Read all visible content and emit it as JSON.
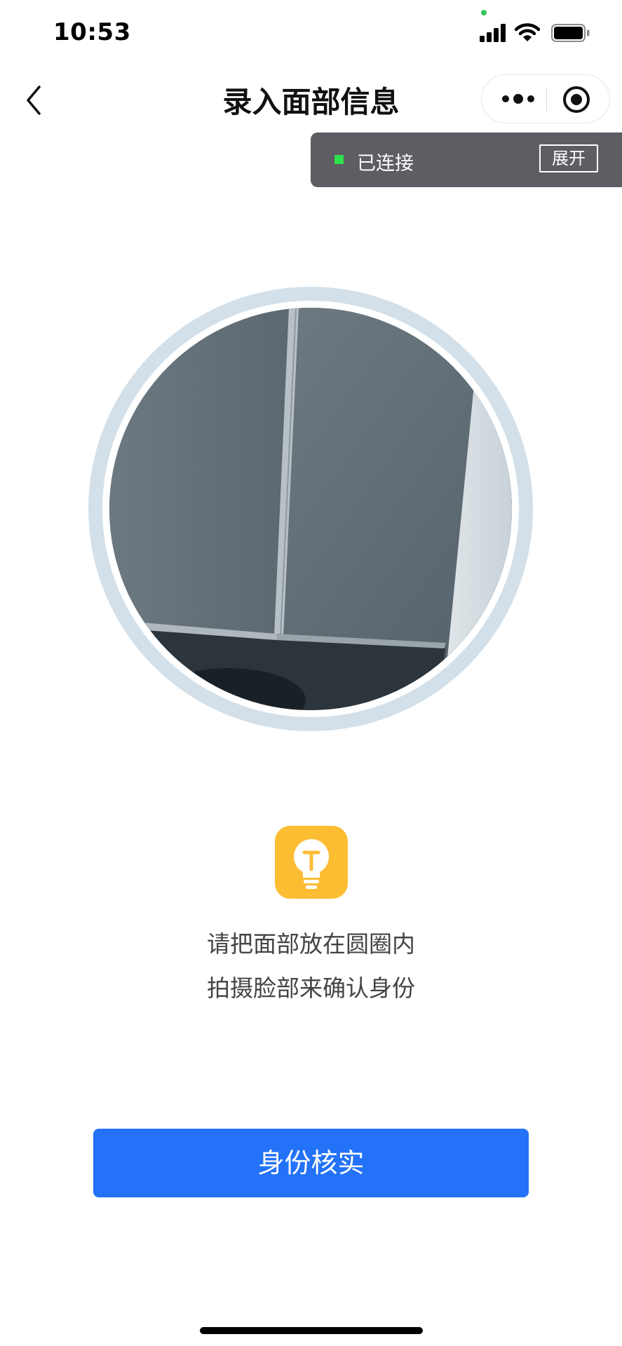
{
  "status_bar": {
    "time": "10:53"
  },
  "nav": {
    "title": "录入面部信息",
    "back_icon": "chevron-left-icon",
    "more_icon": "more-dots-icon",
    "close_icon": "target-circle-icon"
  },
  "connection": {
    "status": "已连接",
    "expand_label": "展开",
    "dot_color": "#2ee04b"
  },
  "tip": {
    "icon": "lightbulb-icon",
    "line1": "请把面部放在圆圈内",
    "line2": "拍摄脸部来确认身份"
  },
  "actions": {
    "verify_label": "身份核实"
  },
  "colors": {
    "primary": "#2372f7",
    "tip_icon_bg": "#fcbd33",
    "ring": "#d3e0ea"
  }
}
